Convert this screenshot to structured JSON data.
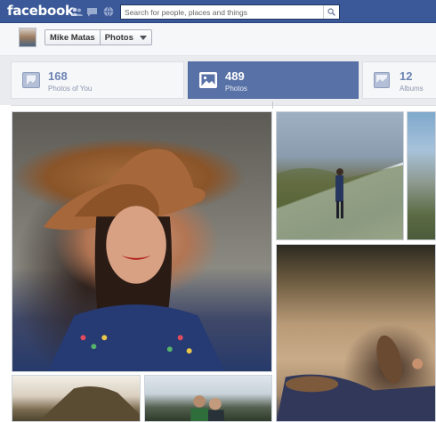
{
  "header": {
    "logo": "facebook",
    "search": {
      "placeholder": "Search for people, places and things"
    }
  },
  "profile": {
    "name": "Mike Matas",
    "section": "Photos"
  },
  "tabs": [
    {
      "count": "168",
      "label": "Photos of You"
    },
    {
      "count": "489",
      "label": "Photos",
      "active": true
    },
    {
      "count": "12",
      "label": "Albums"
    }
  ],
  "photos": [
    {
      "subject": "woman in hat"
    },
    {
      "subject": "hiker on snowy slope"
    },
    {
      "subject": "mountain"
    },
    {
      "subject": "person resting on rocks"
    },
    {
      "subject": "cliff"
    },
    {
      "subject": "friends with headphones"
    }
  ],
  "colors": {
    "brand": "#3b5998",
    "active_tab": "#5872a7"
  },
  "icons": [
    "friend-requests-icon",
    "messages-icon",
    "notifications-icon",
    "search-icon",
    "chevron-down-icon",
    "photos-of-you-icon",
    "photos-icon",
    "albums-icon"
  ]
}
